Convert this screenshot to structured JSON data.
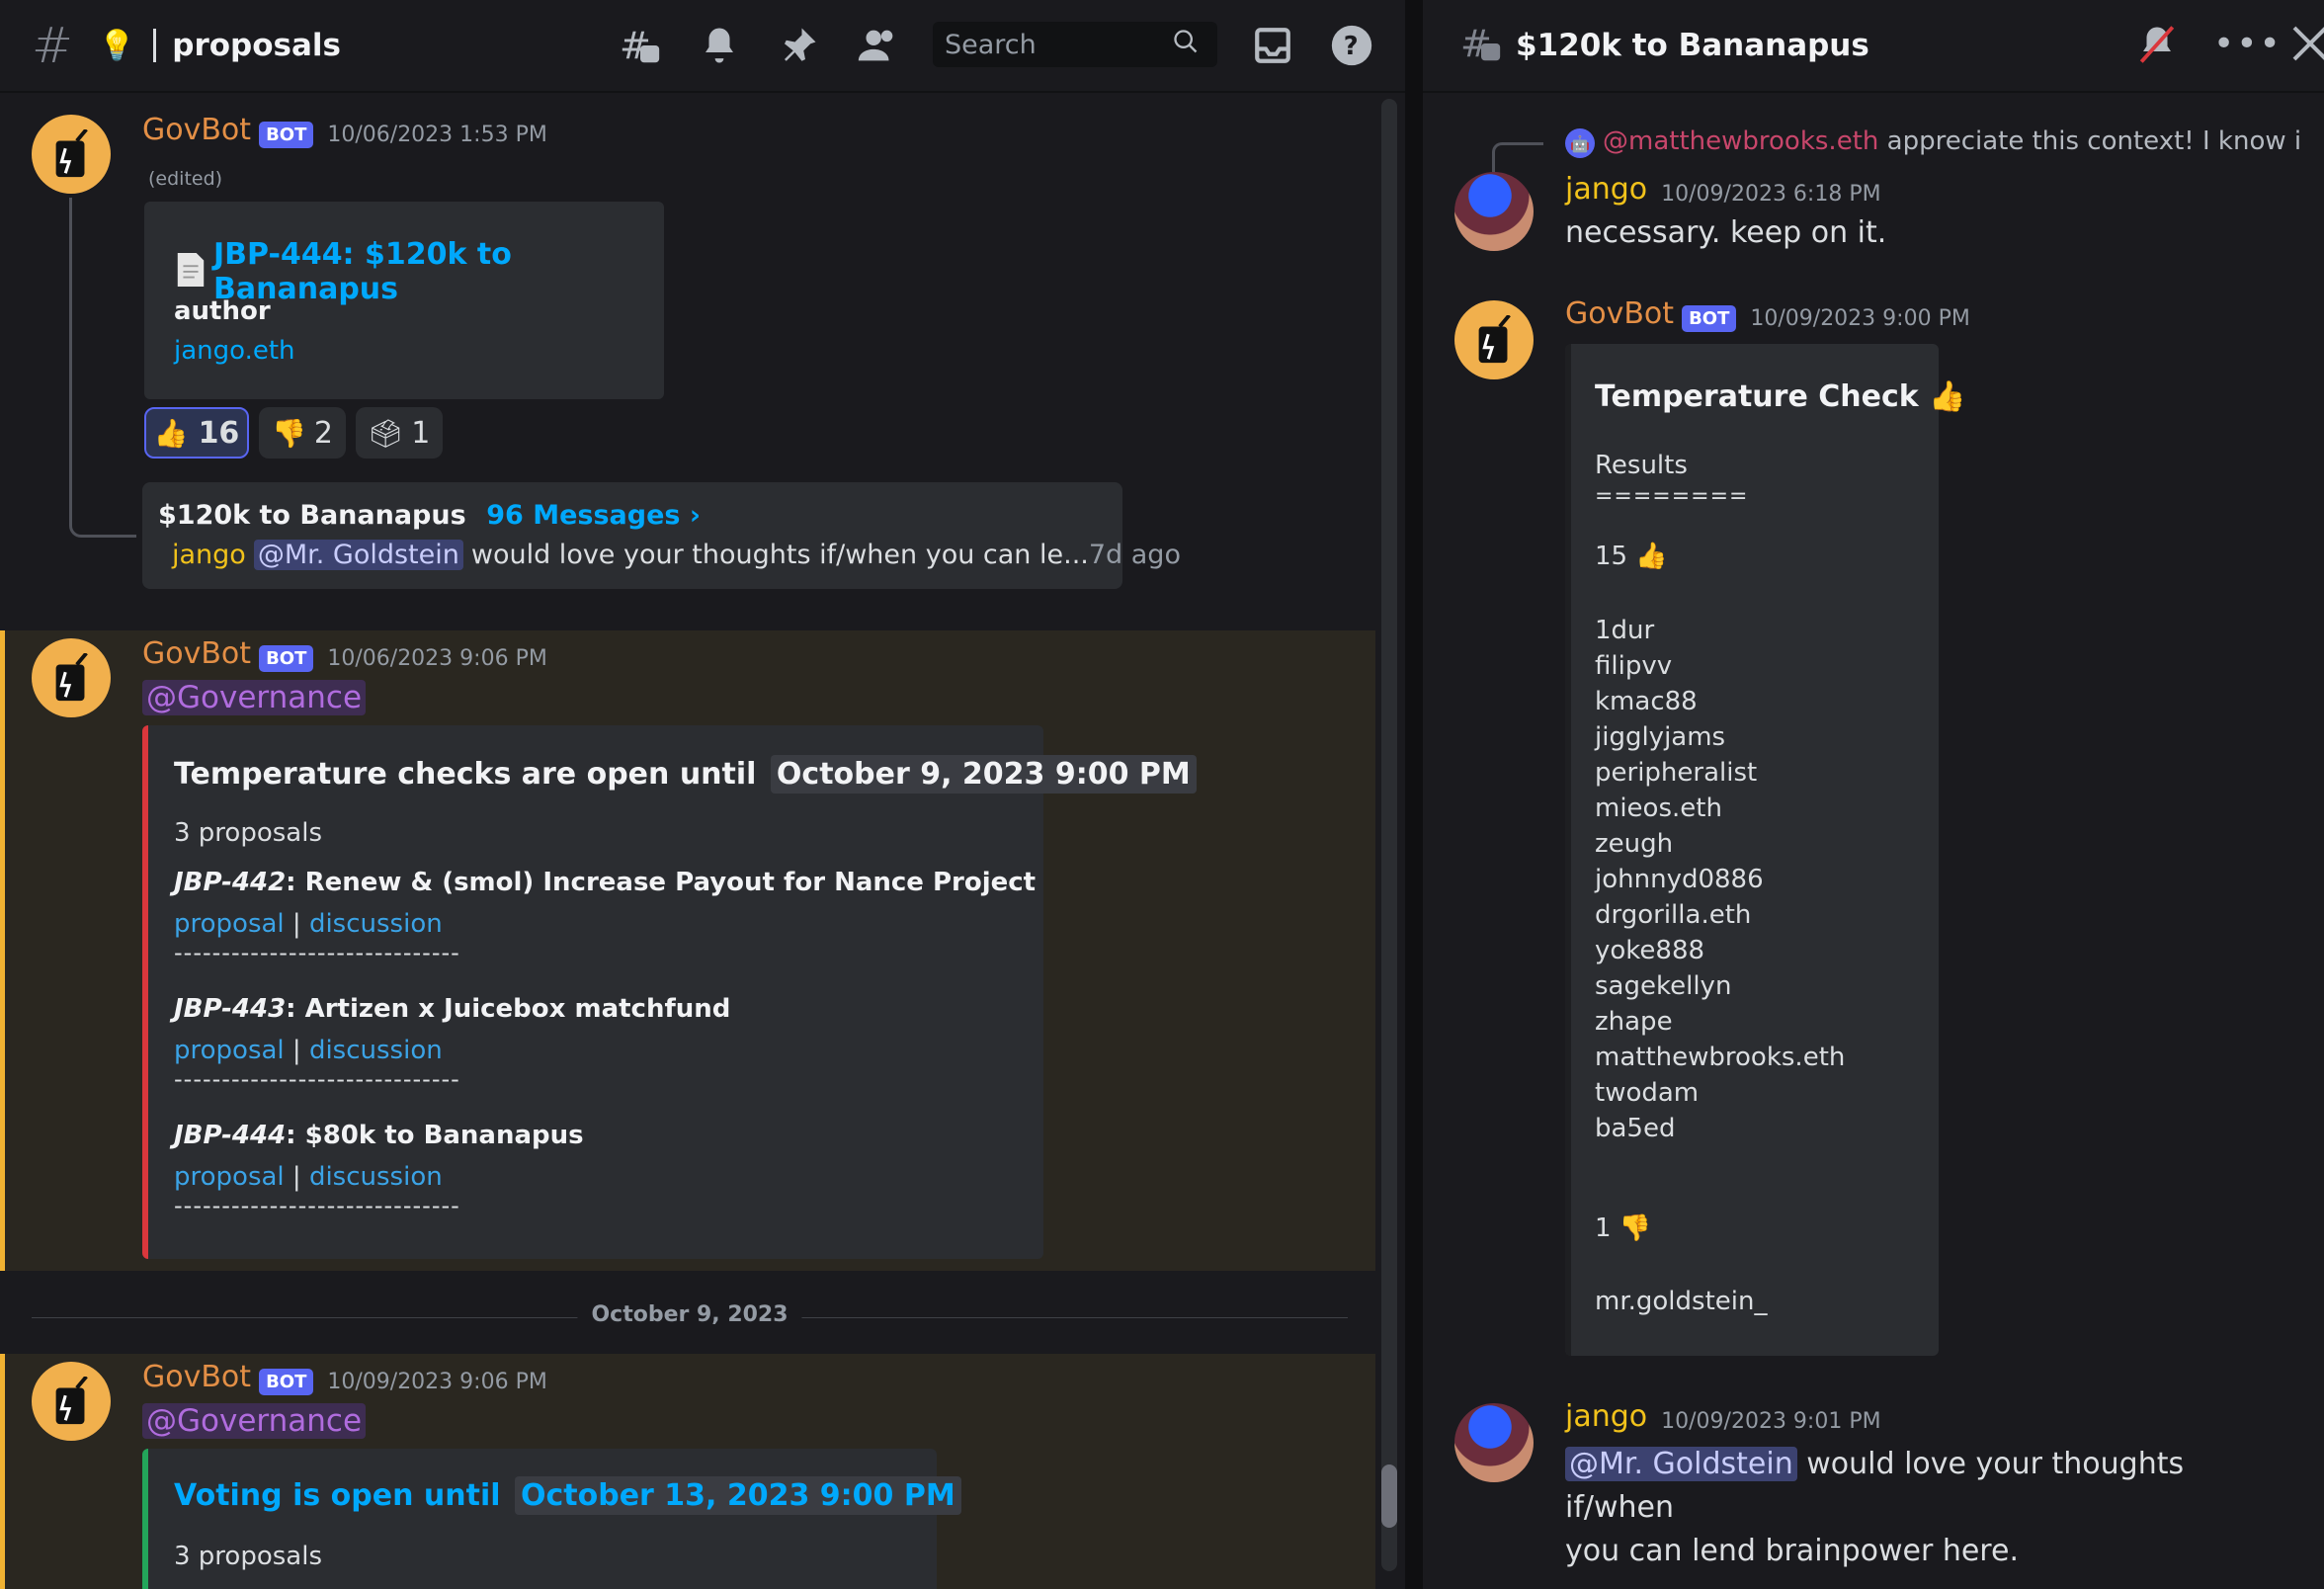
{
  "left_header": {
    "channel_name": "proposals",
    "search_placeholder": "Search"
  },
  "right_header": {
    "thread_title": "$120k to Bananapus"
  },
  "messages_left": {
    "m1": {
      "author": "GovBot",
      "bot_tag": "BOT",
      "time": "10/06/2023 1:53 PM",
      "edited": "(edited)",
      "embed_title": "JBP-444: $120k to Bananapus",
      "field_label": "author",
      "field_value": "jango.eth",
      "reactions": [
        {
          "emoji": "thumbs-up",
          "count": "16"
        },
        {
          "emoji": "thumbs-down",
          "count": "2"
        },
        {
          "emoji": "ballot-box",
          "count": "1"
        }
      ],
      "thread": {
        "name": "$120k to Bananapus",
        "count": "96 Messages ›",
        "last_author": "jango",
        "last_mention": "@Mr. Goldstein",
        "last_text": "would love your thoughts if/when you can le...",
        "ago": "7d ago"
      }
    },
    "m2": {
      "author": "GovBot",
      "bot_tag": "BOT",
      "time": "10/06/2023 9:06 PM",
      "role_mention": "@Governance",
      "embed_heading": "Temperature checks are open until",
      "embed_heading_time": "October 9, 2023 9:00 PM",
      "count_text": "3 proposals",
      "items": [
        {
          "id": "JBP-442",
          "title": ": Renew & (smol) Increase Payout for Nance Project"
        },
        {
          "id": "JBP-443",
          "title": ": Artizen x Juicebox matchfund"
        },
        {
          "id": "JBP-444",
          "title": ": $80k to Bananapus"
        }
      ],
      "link_proposal": "proposal",
      "link_sep": "|",
      "link_discussion": "discussion",
      "separator": "------------------------------"
    },
    "date_divider": "October 9, 2023",
    "m3": {
      "author": "GovBot",
      "bot_tag": "BOT",
      "time": "10/09/2023 9:06 PM",
      "role_mention": "@Governance",
      "embed_heading": "Voting is open until",
      "embed_heading_time": "October 13, 2023 9:00 PM",
      "count_text": "3 proposals"
    }
  },
  "messages_right": {
    "reply_preview": {
      "mention": "@matthewbrooks.eth",
      "text": "appreciate this context! I know i"
    },
    "r1": {
      "author": "jango",
      "time": "10/09/2023 6:18 PM",
      "text": "necessary. keep on it."
    },
    "r2": {
      "author": "GovBot",
      "bot_tag": "BOT",
      "time": "10/09/2023 9:00 PM",
      "embed_title": "Temperature Check",
      "results_label": "Results",
      "underline": "========",
      "yes_count": "15",
      "yes_voters": [
        "1dur",
        "filipvv",
        "kmac88",
        "jigglyjams",
        "peripheralist",
        "mieos.eth",
        "zeugh",
        "johnnyd0886",
        "drgorilla.eth",
        "yoke888",
        "sagekellyn",
        "zhape",
        "matthewbrooks.eth",
        "twodam",
        "ba5ed"
      ],
      "no_count": "1",
      "no_voters": [
        "mr.goldstein_"
      ]
    },
    "r3": {
      "author": "jango",
      "time": "10/09/2023 9:01 PM",
      "mention": "@Mr. Goldstein",
      "text_a": "would love your thoughts if/when",
      "text_b": "you can lend brainpower here."
    }
  },
  "colors": {
    "accent": "#5865f2",
    "govbot": "#e38f46",
    "jango": "#f1c21b",
    "link": "#00a8fc",
    "highlight_bg": "#2a2720",
    "highlight_bar": "#f0b232"
  }
}
